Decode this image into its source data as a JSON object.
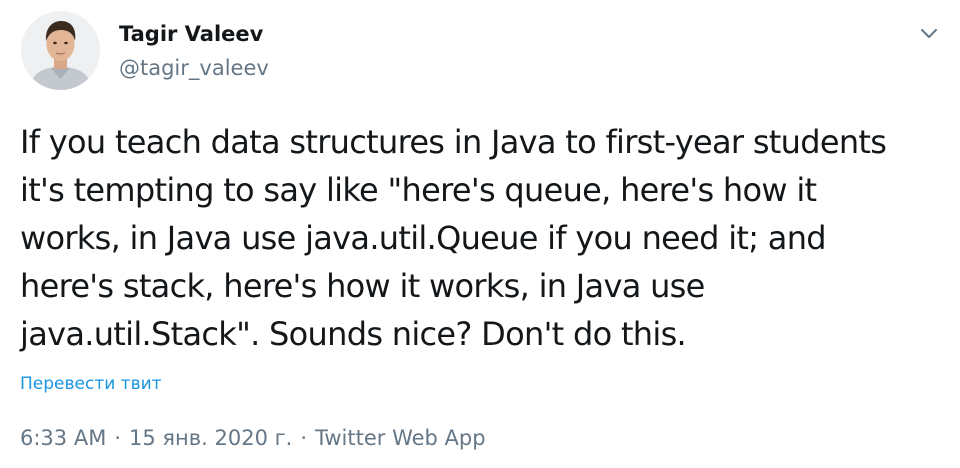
{
  "author": {
    "name": "Tagir Valeev",
    "handle": "@tagir_valeev"
  },
  "tweet": {
    "lines": [
      "If you teach data structures in Java to first-year students",
      "it's tempting to say like \"here's queue, here's how it",
      "works, in Java use java.util.Queue if you need it; and",
      "here's stack, here's how it works, in Java use",
      "java.util.Stack\". Sounds nice? Don't do this."
    ],
    "translate_label": "Перевести твит",
    "time": "6:33 AM",
    "separator": "·",
    "date": "15 янв. 2020 г.",
    "source": "Twitter Web App"
  },
  "icons": {
    "avatar": "user-avatar-photo",
    "menu": "chevron-down-icon"
  },
  "colors": {
    "text": "#14171a",
    "secondary": "#657786",
    "link": "#1b95e0"
  }
}
